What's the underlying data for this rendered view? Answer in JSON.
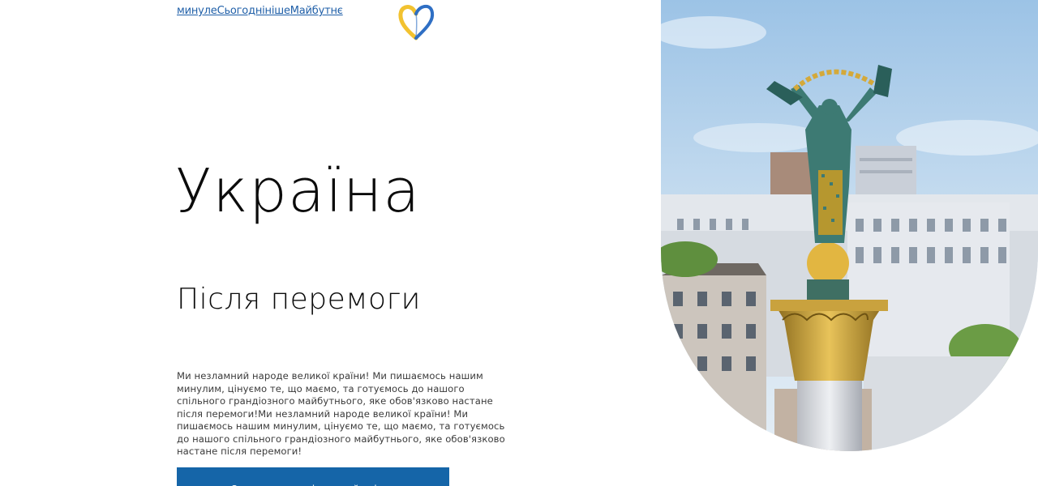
{
  "nav": {
    "items": [
      {
        "label": "минуле"
      },
      {
        "label": "Сьогодні"
      },
      {
        "label": "ніше"
      },
      {
        "label": "Майбутнє"
      }
    ]
  },
  "logo": {
    "icon": "heart-icon",
    "colors": [
      "#f2c230",
      "#2f6fc4"
    ]
  },
  "hero": {
    "title": "Україна",
    "subtitle": "Після перемоги",
    "paragraph": "Ми незламний народе великої країни! Ми пишаємось нашим минулим, цінуємо те, що маємо, та готуємось до нашого спільного грандіозного майбутнього, яке обов'язково настане після перемоги!Ми незламний народе великої країни! Ми пишаємось нашим минулим, цінуємо те, що маємо, та готуємось до нашого спільного грандіозного майбутнього, яке обов'язково настане після перемоги!",
    "cta_label": "Отримати патріотичний стікер"
  },
  "image": {
    "subject": "independence-monument-kyiv"
  },
  "colors": {
    "link": "#1f5fa8",
    "button": "#1565a8"
  }
}
